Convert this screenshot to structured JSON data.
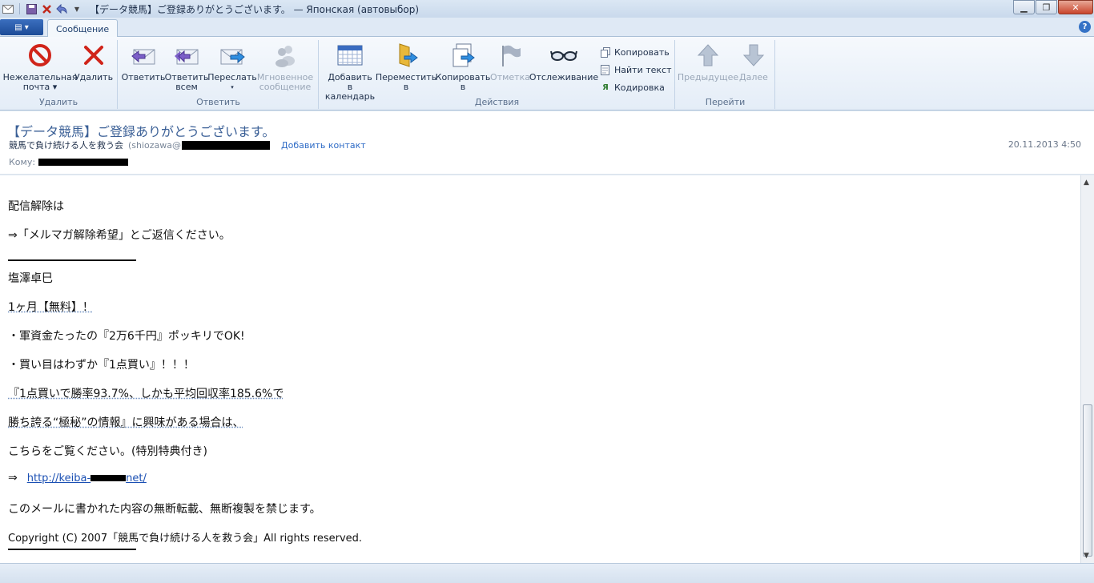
{
  "window": {
    "title": "【データ競馬】ご登録ありがとうございます。 — Японская (автовыбор)"
  },
  "tabs": {
    "active": "Сообщение"
  },
  "ribbon": {
    "groups": [
      {
        "label": "Удалить"
      },
      {
        "label": "Ответить"
      },
      {
        "label": "Действия"
      },
      {
        "label": "Перейти"
      }
    ],
    "buttons": {
      "junk": [
        "Нежелательная",
        "почта ▾"
      ],
      "delete": [
        "Удалить"
      ],
      "reply": [
        "Ответить"
      ],
      "reply_all": [
        "Ответить",
        "всем"
      ],
      "forward": [
        "Переслать",
        "▾"
      ],
      "instant": [
        "Мгновенное",
        "сообщение"
      ],
      "calendar": [
        "Добавить в",
        "календарь"
      ],
      "move": [
        "Переместить",
        "в"
      ],
      "copy_to": [
        "Копировать",
        "в"
      ],
      "flag": [
        "Отметка"
      ],
      "watch": [
        "Отслеживание"
      ],
      "copy": "Копировать",
      "find": "Найти текст",
      "encoding": "Кодировка",
      "prev": [
        "Предыдущее"
      ],
      "next": [
        "Далее"
      ]
    }
  },
  "message": {
    "subject": "【データ競馬】ご登録ありがとうございます。",
    "from_name": "競馬で負け続ける人を救う会",
    "from_addr_prefix": "(shiozawa@",
    "add_contact": "Добавить контакт",
    "date": "20.11.2013 4:50",
    "to_label": "Кому:",
    "body": {
      "l1": "配信解除は",
      "l2": "⇒「メルマガ解除希望」とご返信ください。",
      "l3": "塩澤卓巳",
      "l4": "1ヶ月【無料】！",
      "l5": "・軍資金たったの『2万6千円』ポッキリでOK!",
      "l6": "・買い目はわずか『1点買い』！！！",
      "l7": "『1点買いで勝率93.7%、しかも平均回収率185.6%で",
      "l8": "勝ち誇る“極秘”の情報』に興味がある場合は、",
      "l9": "こちらをご覧ください。(特別特典付き)",
      "arrow": "⇒",
      "link_a": "http://keiba-",
      "link_b": "net/",
      "l10": "このメールに書かれた内容の無断転載、無断複製を禁じます。",
      "l11": "Copyright (C) 2007「競馬で負け続ける人を救う会」All rights reserved."
    }
  }
}
